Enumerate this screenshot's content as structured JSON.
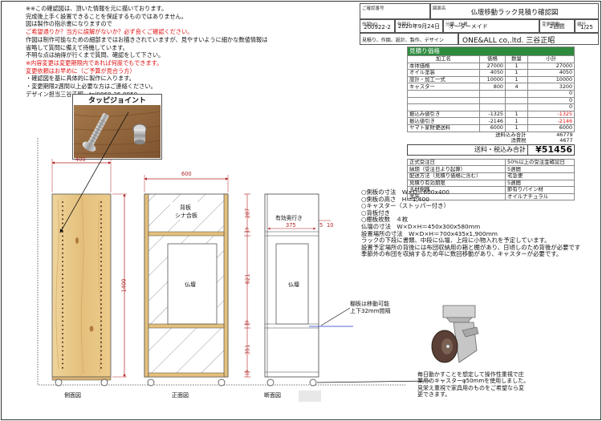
{
  "notes": [
    {
      "text": "※※この確認図は、頂いた情報を元に描いております。",
      "style": "black"
    },
    {
      "text": "完成後上手く設置できることを保証するものではありません。",
      "style": "black"
    },
    {
      "text": "図は製作の指示書になりますので",
      "style": "black"
    },
    {
      "text": "ご希望通りか？当方に誤解がないか？必ず良くご確認ください。",
      "style": "red"
    },
    {
      "text": "作図は制作可能なための細部まではお描きされていますが、見やすいように細かな数値情報は",
      "style": "black"
    },
    {
      "text": "省略して質問に備えて待機しています。",
      "style": "black"
    },
    {
      "text": "不明な点は納得が行くまで質問、確認をして下さい。",
      "style": "black"
    },
    {
      "text": "※内容変更は変更期限内であれば何度でもできます。",
      "style": "black"
    },
    {
      "text": "変更依頼はお早めに（ご予算が見合う方）",
      "style": "red"
    },
    {
      "text": "・確認図を基に具体的に製作に入ります。",
      "style": "black"
    },
    {
      "text": "・変更期限2週間以上必要な方はご連絡ください。",
      "style": "black"
    },
    {
      "text": "デザイン担当三谷正昭　tel0868-36-8950",
      "style": "black"
    }
  ],
  "title_block": {
    "confirm_no_label": "ご確認番号",
    "figure_name_label": "図面名",
    "figure_name": "仏壇移動ラック見積り確認図",
    "drawing_no_label": "作図NO.",
    "drawing_no": "200922-2",
    "date_label": "作図日",
    "date": "2020年9月24日",
    "category_label": "分類、仕様",
    "category": "オーダーメイド",
    "deadline_label": "変更期限",
    "deadline": "2週間",
    "scale_label": "縮尺",
    "scale": "1/25",
    "note_line": "見積り、作図、設計、製作、デザイン",
    "company": "ONE&ALL co,.ltd. 三谷正昭"
  },
  "estimate": {
    "title": "見積り価格",
    "headers": [
      "加工名",
      "価格",
      "数量",
      "小計"
    ],
    "rows": [
      {
        "name": "本体価格",
        "price": "27000",
        "qty": "1",
        "subtotal": "27000",
        "neg": false
      },
      {
        "name": "オイル塗装",
        "price": "4050",
        "qty": "1",
        "subtotal": "4050",
        "neg": false
      },
      {
        "name": "設計・加工一式",
        "price": "10000",
        "qty": "1",
        "subtotal": "10000",
        "neg": false
      },
      {
        "name": "キャスター",
        "price": "800",
        "qty": "4",
        "subtotal": "3200",
        "neg": false
      },
      {
        "name": "",
        "price": "",
        "qty": "",
        "subtotal": "0",
        "neg": false
      },
      {
        "name": "",
        "price": "",
        "qty": "",
        "subtotal": "0",
        "neg": false
      },
      {
        "name": "",
        "price": "",
        "qty": "",
        "subtotal": "0",
        "neg": false
      },
      {
        "name": "振込み値引き",
        "price": "-1325",
        "qty": "1",
        "subtotal": "-1325",
        "neg": true
      },
      {
        "name": "振込値引き",
        "price": "-2146",
        "qty": "1",
        "subtotal": "-2146",
        "neg": true
      },
      {
        "name": "ヤマト家財便送料",
        "price": "6000",
        "qty": "1",
        "subtotal": "6000",
        "neg": false
      }
    ],
    "subtotal_label": "送料込み合計",
    "subtotal_value": "46779",
    "tax_label": "消費税",
    "tax_value": "4677",
    "total_label": "送料・税込み合計",
    "total_value": "¥51456",
    "info": [
      {
        "label": "正式受注日",
        "value": "50%以上の受注金確認日"
      },
      {
        "label": "納期（受注日より起算）",
        "value": "5週間"
      },
      {
        "label": "配送方法（見積り価格に含む）",
        "value": "宅急便"
      },
      {
        "label": "見積り有効期限",
        "value": "5週間"
      },
      {
        "label": "主材樹種",
        "value": "節有りパイン材"
      },
      {
        "label": "塗装",
        "value": "オイルナチュラル"
      }
    ]
  },
  "spec_lines": [
    "○側板の寸法　W×D＝600x400",
    "○側板の高さ　H＝1,400",
    "○キャスター（ストッパー付き）",
    "○背板付き",
    "○棚板枚数　４枚",
    "仏壇の寸法　W×D×H＝450x300x580mm",
    "設置場所の寸法　W×D×H＝700x435x1,900mm",
    "ラックの下段に書類、中段に仏壇、上段に小物入れを予定しています。",
    "設置予定場所の背後には布団収納用の箱と棚があり、日頃しのため背後が必要です",
    "季節外の布団を収納するため年に数回移動があり、キャスターが必要です。"
  ],
  "joint_label": "タッピジョイント",
  "views": {
    "side_label": "側面図",
    "front_label": "正面図",
    "section_label": "断面図",
    "side_width": "400",
    "side_height": "1400",
    "front_width": "600",
    "back_panel_line1": "背板",
    "back_panel_line2": "シナ合板",
    "butsudan_front": "仏壇",
    "butsudan_section": "仏壇",
    "effective_depth": "有効奥行き",
    "section_depth": "375",
    "section_gap_a": "5",
    "section_gap_b": "10",
    "section_heights": [
      "287",
      "19",
      "621",
      "19",
      "351",
      "19"
    ],
    "shelf_note_line1": "棚板は移動可能",
    "shelf_note_line2": "上下32mm間隔"
  },
  "caster_note": [
    "毎日動かすことを想定して操作性重視で庄",
    "業用のキャスターφ50mmを使用しました。",
    "見栄え重視で家具用のものをご希望なら変",
    "更できます。"
  ],
  "colors": {
    "estimate_header": "#2e8b3e",
    "wood": "#e3c07e",
    "dimension": "#b02020",
    "negative": "#e01010",
    "leader": "#2233cc"
  }
}
